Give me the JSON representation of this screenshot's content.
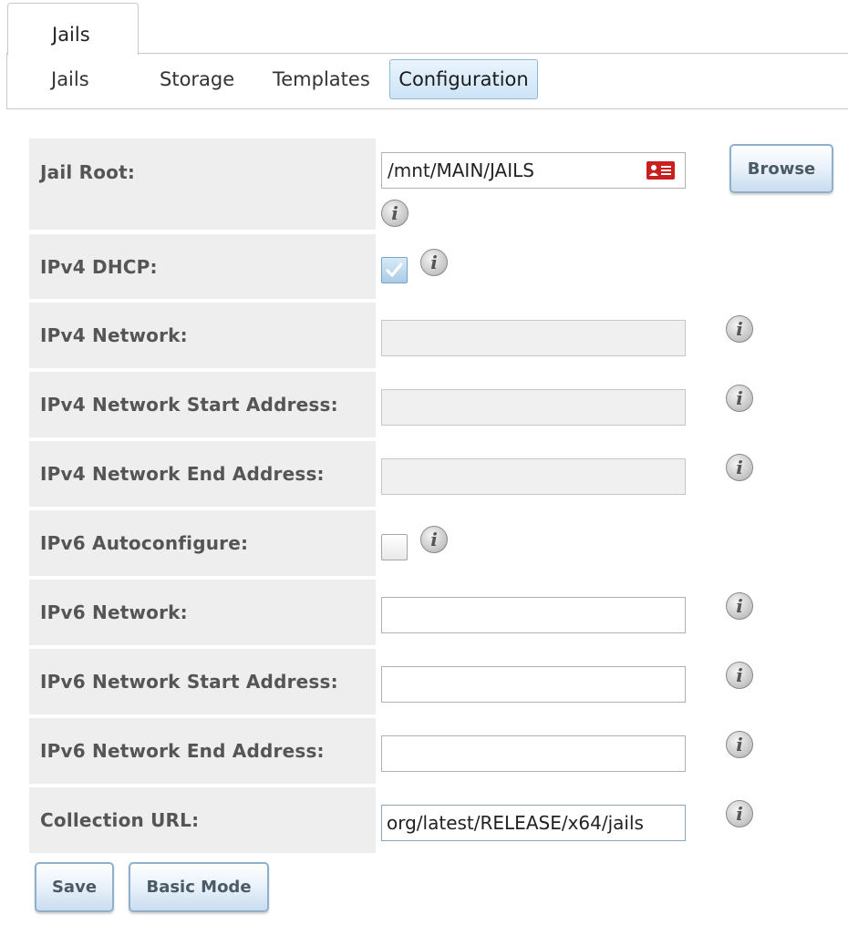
{
  "top_tab": {
    "label": "Jails"
  },
  "subtabs": [
    {
      "label": "Jails"
    },
    {
      "label": "Storage"
    },
    {
      "label": "Templates"
    },
    {
      "label": "Configuration",
      "active": true
    }
  ],
  "form": {
    "jail_root": {
      "label": "Jail Root:",
      "value": "/mnt/MAIN/JAILS"
    },
    "browse_label": "Browse",
    "ipv4_dhcp": {
      "label": "IPv4 DHCP:",
      "checked": true
    },
    "ipv4_network": {
      "label": "IPv4 Network:",
      "value": "",
      "disabled": true
    },
    "ipv4_start": {
      "label": "IPv4 Network Start Address:",
      "value": "",
      "disabled": true
    },
    "ipv4_end": {
      "label": "IPv4 Network End Address:",
      "value": "",
      "disabled": true
    },
    "ipv6_autoconf": {
      "label": "IPv6 Autoconfigure:",
      "checked": false
    },
    "ipv6_network": {
      "label": "IPv6 Network:",
      "value": ""
    },
    "ipv6_start": {
      "label": "IPv6 Network Start Address:",
      "value": ""
    },
    "ipv6_end": {
      "label": "IPv6 Network End Address:",
      "value": ""
    },
    "collection_url": {
      "label": "Collection URL:",
      "value": "org/latest/RELEASE/x64/jails"
    }
  },
  "buttons": {
    "save": "Save",
    "basic_mode": "Basic Mode"
  },
  "icons": {
    "info": "info-icon",
    "address_card": "address-card-icon",
    "check": "checkmark-icon"
  },
  "info_glyph": "i",
  "colors": {
    "active_tab_bg": "#cde4f7",
    "label_bg": "#eeeeee",
    "card_icon": "#c81f1f"
  }
}
